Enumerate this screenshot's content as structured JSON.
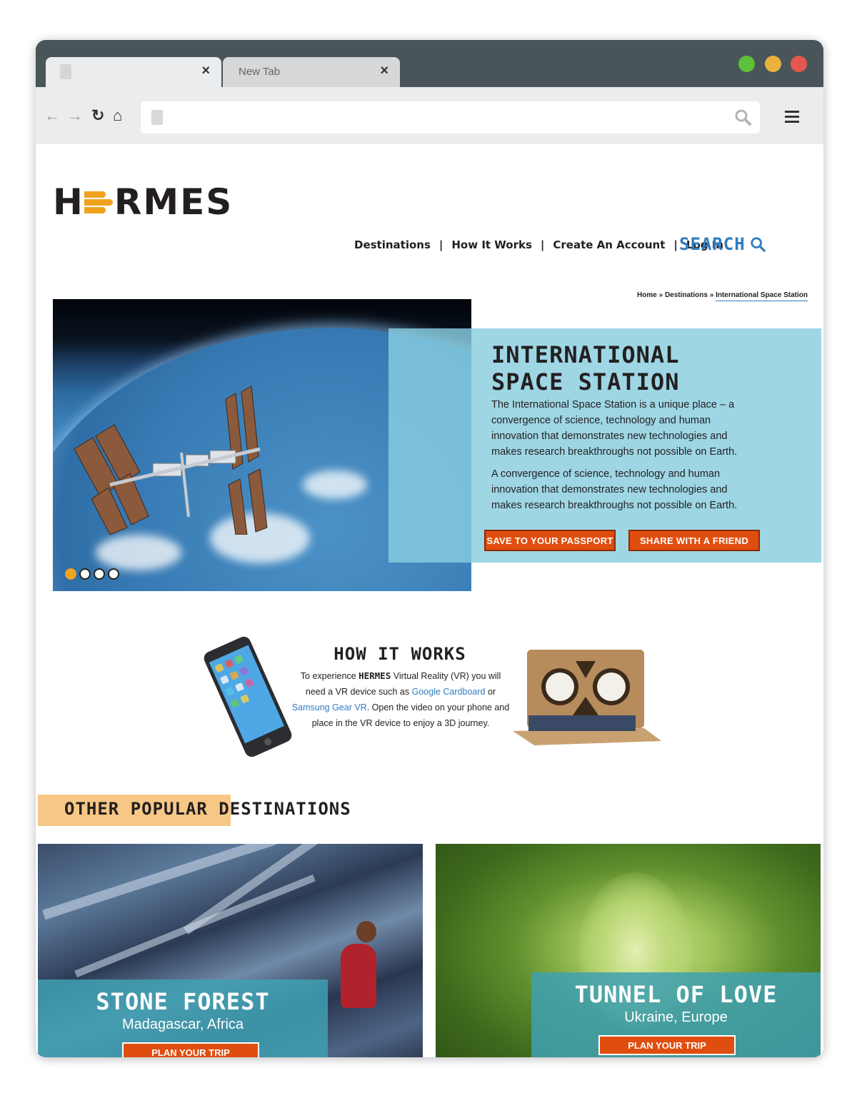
{
  "browser": {
    "tabs": [
      {
        "label": "",
        "active": true
      },
      {
        "label": "New Tab",
        "active": false
      }
    ],
    "close_glyph": "×",
    "url": ""
  },
  "site": {
    "logo": "HERMES",
    "nav": [
      "Destinations",
      "How It Works",
      "Create An Account",
      "Log In"
    ],
    "nav_separator": "|",
    "search_label": "SEARCH",
    "breadcrumb": {
      "home": "Home",
      "sep": "»",
      "destinations": "Destinations",
      "current": "International Space Station"
    }
  },
  "hero": {
    "title_line1": "INTERNATIONAL",
    "title_line2": "SPACE STATION",
    "paragraph1": "The International Space Station is a unique place – a convergence of science, technology and human innovation that demonstrates new technologies and makes research breakthroughs not possible on Earth.",
    "paragraph2": "A convergence of science, technology and human innovation that demonstrates new technologies and makes research breakthroughs not possible on Earth.",
    "button_passport": "SAVE TO YOUR PASSPORT",
    "button_share": "SHARE WITH A FRIEND",
    "carousel_slides": 4,
    "carousel_active": 1
  },
  "how_it_works": {
    "title": "HOW IT WORKS",
    "text_before": "To experience",
    "brand": "HERMES",
    "text_mid": "Virtual Reality (VR) you will need a VR device such as",
    "link1": "Google Cardboard",
    "text_or": "or",
    "link2": "Samsung Gear VR",
    "text_after": ". Open the video on your phone and place in the VR device to enjoy a 3D journey."
  },
  "popular": {
    "heading": "OTHER POPULAR DESTINATIONS",
    "cards": [
      {
        "title": "STONE FOREST",
        "location": "Madagascar, Africa",
        "button": "PLAN YOUR TRIP"
      },
      {
        "title": "TUNNEL OF LOVE",
        "location": "Ukraine, Europe",
        "button": "PLAN YOUR TRIP"
      }
    ]
  },
  "colors": {
    "accent_orange": "#e04e0f",
    "accent_yellow": "#f0a21e",
    "link_blue": "#2f7cc1",
    "panel_blue": "#9ed6e4",
    "heading_bg": "#f7c786"
  }
}
